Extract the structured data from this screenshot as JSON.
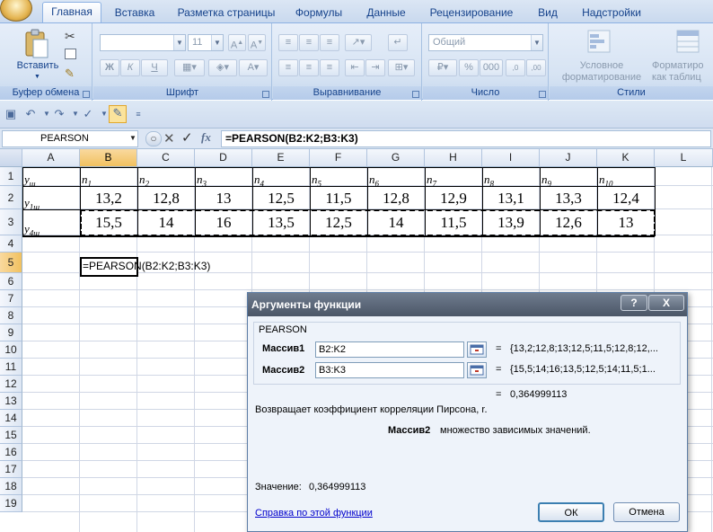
{
  "ribbon": {
    "tabs": [
      "Главная",
      "Вставка",
      "Разметка страницы",
      "Формулы",
      "Данные",
      "Рецензирование",
      "Вид",
      "Надстройки"
    ],
    "active_tab": "Главная",
    "groups": {
      "clipboard": "Буфер обмена",
      "font": "Шрифт",
      "alignment": "Выравнивание",
      "number": "Число",
      "styles": "Стили"
    },
    "paste_label": "Вставить",
    "font_size": "11",
    "number_format": "Общий",
    "bold": "Ж",
    "italic": "К",
    "underline": "Ч",
    "cond_format_label_1": "Условное",
    "cond_format_label_2": "форматирование",
    "format_table_label_1": "Форматиро",
    "format_table_label_2": "как таблиц"
  },
  "formula_bar": {
    "name_box": "PEARSON",
    "fx": "fx",
    "formula": "=PEARSON(B2:K2;B3:K3)"
  },
  "sheet": {
    "columns": [
      "A",
      "B",
      "C",
      "D",
      "E",
      "F",
      "G",
      "H",
      "I",
      "J",
      "K",
      "L"
    ],
    "rows": [
      "1",
      "2",
      "3",
      "4",
      "5",
      "6",
      "7",
      "8",
      "9",
      "10",
      "11",
      "12",
      "13",
      "14",
      "15",
      "16",
      "17",
      "18",
      "19"
    ],
    "table": {
      "row1": [
        "y",
        "n",
        "n",
        "n",
        "n",
        "n",
        "n",
        "n",
        "n",
        "n",
        "n"
      ],
      "row1_subs": [
        "ш",
        "1",
        "2",
        "3",
        "4",
        "5",
        "6",
        "7",
        "8",
        "9",
        "10"
      ],
      "row2_label": "y",
      "row2_sub": "1ш",
      "row2": [
        "13,2",
        "12,8",
        "13",
        "12,5",
        "11,5",
        "12,8",
        "12,9",
        "13,1",
        "13,3",
        "12,4"
      ],
      "row3_label": "y",
      "row3_sub": "4ш",
      "row3": [
        "15,5",
        "14",
        "16",
        "13,5",
        "12,5",
        "14",
        "11,5",
        "13,9",
        "12,6",
        "13"
      ]
    },
    "b5_text": "=PEARSON(B2:K2;B3:K3)"
  },
  "dialog": {
    "title": "Аргументы функции",
    "help_btn": "?",
    "close_btn": "X",
    "function_name": "PEARSON",
    "arg1_label": "Массив1",
    "arg1_value": "B2:K2",
    "arg1_result": "{13,2;12,8;13;12,5;11,5;12,8;12,...",
    "arg2_label": "Массив2",
    "arg2_value": "B3:K3",
    "arg2_result": "{15,5;14;16;13,5;12,5;14;11,5;1...",
    "eq": "=",
    "result": "0,364999113",
    "description": "Возвращает коэффициент корреляции Пирсона, r.",
    "arg_desc_name": "Массив2",
    "arg_desc_text": "множество зависимых значений.",
    "value_label": "Значение:",
    "value": "0,364999113",
    "help_link": "Справка по этой функции",
    "ok": "ОК",
    "cancel": "Отмена"
  }
}
